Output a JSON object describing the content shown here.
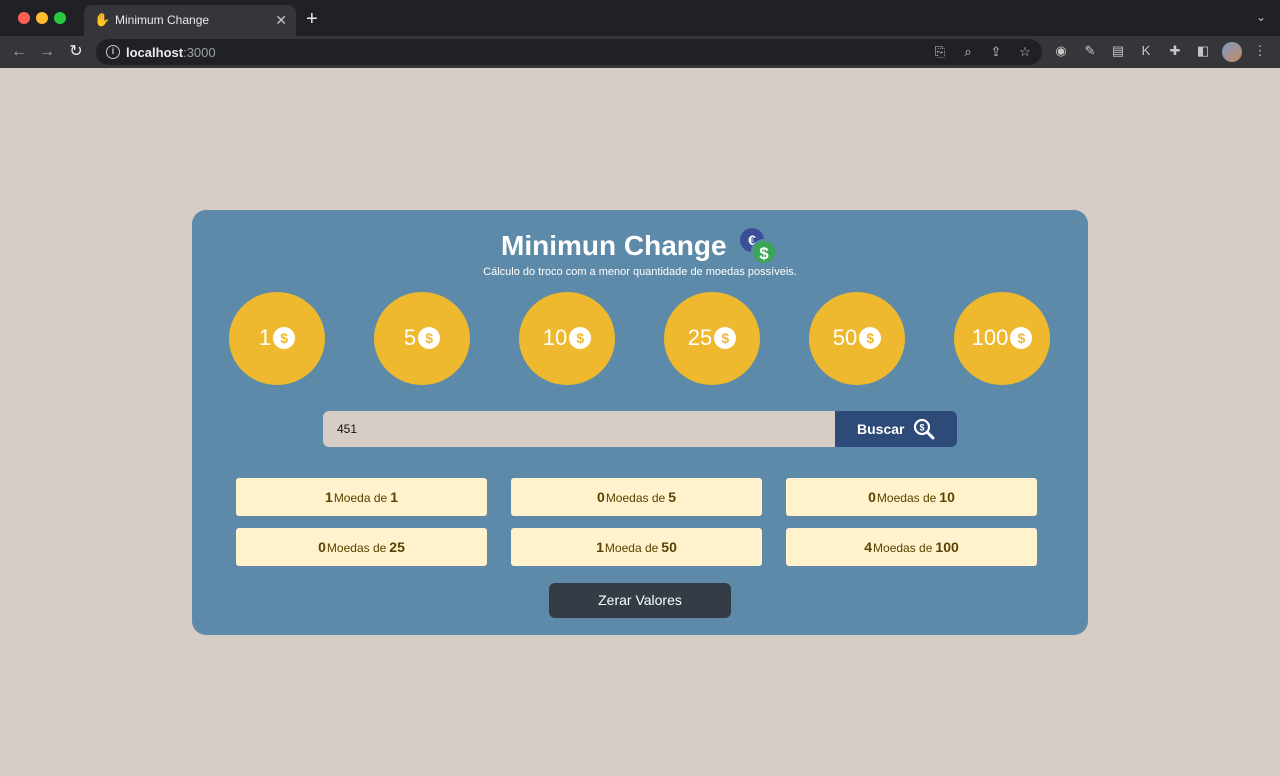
{
  "browser": {
    "tab_title": "Minimum Change",
    "url_host": "localhost",
    "url_port": ":3000"
  },
  "app": {
    "title": "Minimun Change",
    "subtitle": "Cálculo do troco com a menor quantidade de moedas possíveis.",
    "coin_symbol": "$",
    "coins": [
      "1",
      "5",
      "10",
      "25",
      "50",
      "100"
    ],
    "search": {
      "value": "451",
      "button_label": "Buscar"
    },
    "results": [
      {
        "count": "1",
        "label": "Moeda de",
        "value": "1"
      },
      {
        "count": "0",
        "label": "Moedas de",
        "value": "5"
      },
      {
        "count": "0",
        "label": "Moedas de",
        "value": "10"
      },
      {
        "count": "0",
        "label": "Moedas de",
        "value": "25"
      },
      {
        "count": "1",
        "label": "Moeda de",
        "value": "50"
      },
      {
        "count": "4",
        "label": "Moedas de",
        "value": "100"
      }
    ],
    "reset_label": "Zerar Valores"
  },
  "colors": {
    "page_bg": "#d6cdc7",
    "card_bg": "#5c8aa8",
    "coin": "#eeb92e",
    "button_primary": "#2d4a78",
    "result_bg": "#fff2cc",
    "reset_bg": "#343c45"
  }
}
